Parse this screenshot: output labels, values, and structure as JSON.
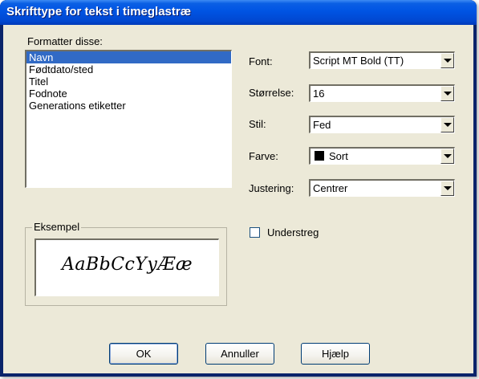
{
  "window": {
    "title": "Skrifttype for tekst i timeglastræ"
  },
  "left": {
    "format_label": "Formatter disse:",
    "items": [
      "Navn",
      "Fødtdato/sted",
      "Titel",
      "Fodnote",
      "Generations etiketter"
    ],
    "selected_index": 0,
    "example_label": "Eksempel",
    "example_text": "AaBbCcYyÆæ"
  },
  "right": {
    "font_label": "Font:",
    "font_value": "Script MT Bold (TT)",
    "size_label": "Størrelse:",
    "size_value": "16",
    "style_label": "Stil:",
    "style_value": "Fed",
    "color_label": "Farve:",
    "color_value": "Sort",
    "color_swatch": "#000000",
    "align_label": "Justering:",
    "align_value": "Centrer",
    "underline_label": "Understreg",
    "underline_checked": false
  },
  "buttons": {
    "ok": "OK",
    "cancel": "Annuller",
    "help": "Hjælp"
  },
  "colors": {
    "titlebar": "#0054e3",
    "dialog_bg": "#ece9d8",
    "selection": "#316ac5"
  }
}
